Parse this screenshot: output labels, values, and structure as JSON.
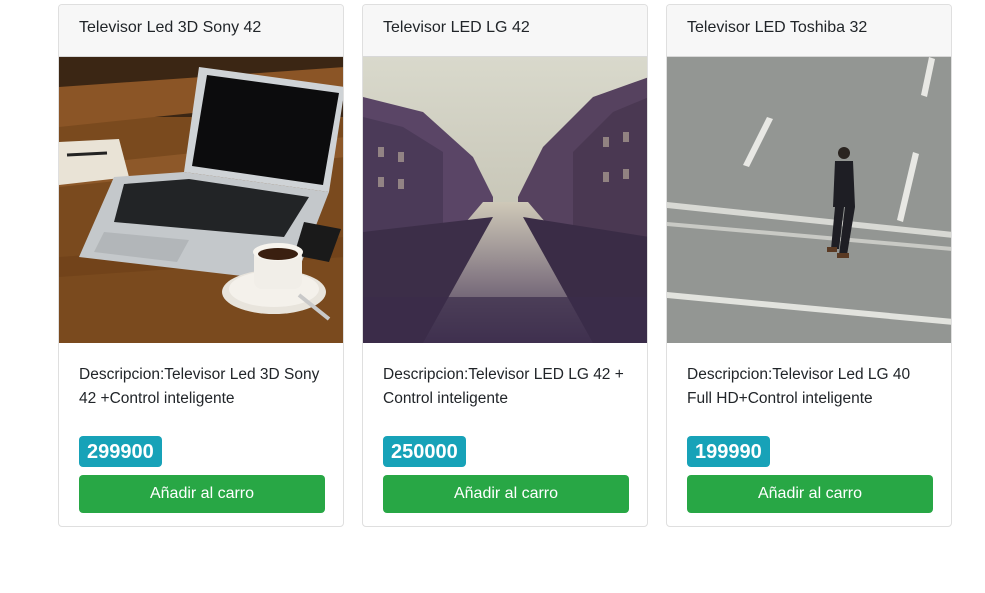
{
  "products": [
    {
      "title": "Televisor Led 3D Sony 42",
      "description": "Descripcion:Televisor Led 3D Sony 42 +Control inteligente",
      "price": "299900",
      "button_label": "Añadir al carro",
      "image": "laptop-on-wooden-desk-photo"
    },
    {
      "title": "Televisor LED LG 42",
      "description": "Descripcion:Televisor LED LG 42 + Control inteligente",
      "price": "250000",
      "button_label": "Añadir al carro",
      "image": "city-canal-photo"
    },
    {
      "title": "Televisor LED Toshiba 32",
      "description": "Descripcion:Televisor Led LG 40 Full HD+Control inteligente",
      "price": "199990",
      "button_label": "Añadir al carro",
      "image": "man-walking-on-street-photo"
    }
  ],
  "colors": {
    "price_badge": "#17a2b8",
    "button": "#28a745",
    "header_bg": "#f7f7f7"
  }
}
